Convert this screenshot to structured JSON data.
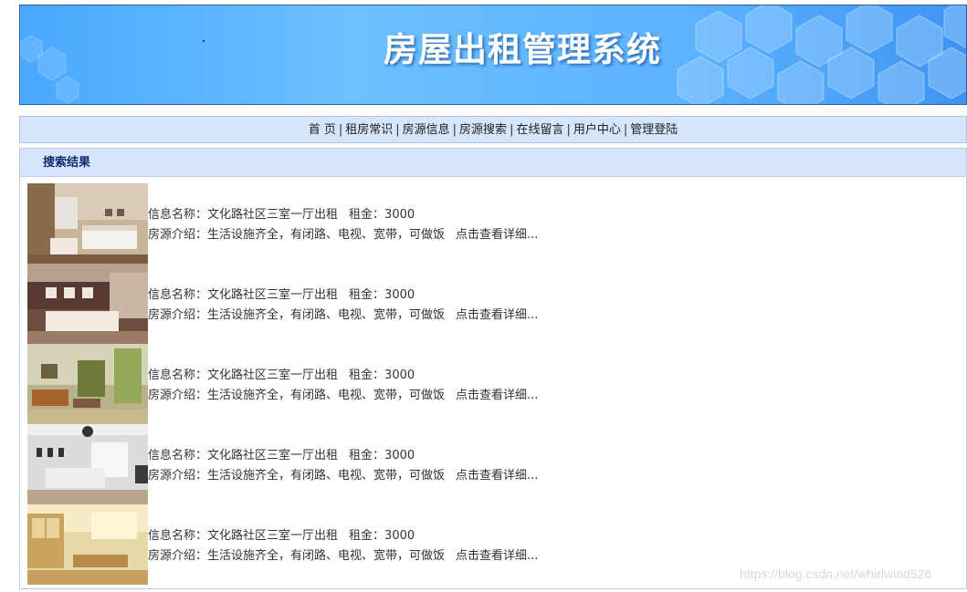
{
  "header": {
    "title": "房屋出租管理系统"
  },
  "nav": {
    "items": [
      {
        "label": "首 页"
      },
      {
        "label": "租房常识"
      },
      {
        "label": "房源信息"
      },
      {
        "label": "房源搜索"
      },
      {
        "label": "在线留言"
      },
      {
        "label": "用户中心"
      },
      {
        "label": "管理登陆"
      }
    ],
    "separator": "|"
  },
  "panel": {
    "title": "搜索结果"
  },
  "results": [
    {
      "name_label": "信息名称：",
      "name": "文化路社区三室一厅出租",
      "rent_label": "租金：",
      "rent": "3000",
      "intro_label": "房源介绍：",
      "intro": "生活设施齐全，有闭路、电视、宽带，可做饭",
      "detail": "点击查看详细..."
    },
    {
      "name_label": "信息名称：",
      "name": "文化路社区三室一厅出租",
      "rent_label": "租金：",
      "rent": "3000",
      "intro_label": "房源介绍：",
      "intro": "生活设施齐全，有闭路、电视、宽带，可做饭",
      "detail": "点击查看详细..."
    },
    {
      "name_label": "信息名称：",
      "name": "文化路社区三室一厅出租",
      "rent_label": "租金：",
      "rent": "3000",
      "intro_label": "房源介绍：",
      "intro": "生活设施齐全，有闭路、电视、宽带，可做饭",
      "detail": "点击查看详细..."
    },
    {
      "name_label": "信息名称：",
      "name": "文化路社区三室一厅出租",
      "rent_label": "租金：",
      "rent": "3000",
      "intro_label": "房源介绍：",
      "intro": "生活设施齐全，有闭路、电视、宽带，可做饭",
      "detail": "点击查看详细..."
    },
    {
      "name_label": "信息名称：",
      "name": "文化路社区三室一厅出租",
      "rent_label": "租金：",
      "rent": "3000",
      "intro_label": "房源介绍：",
      "intro": "生活设施齐全，有闭路、电视、宽带，可做饭",
      "detail": "点击查看详细..."
    }
  ],
  "watermark": "https://blog.csdn.net/whirlwind526",
  "colors": {
    "banner_blue": "#4aa8ff",
    "nav_bg": "#d5e6fa",
    "panel_title": "#102a6e"
  }
}
